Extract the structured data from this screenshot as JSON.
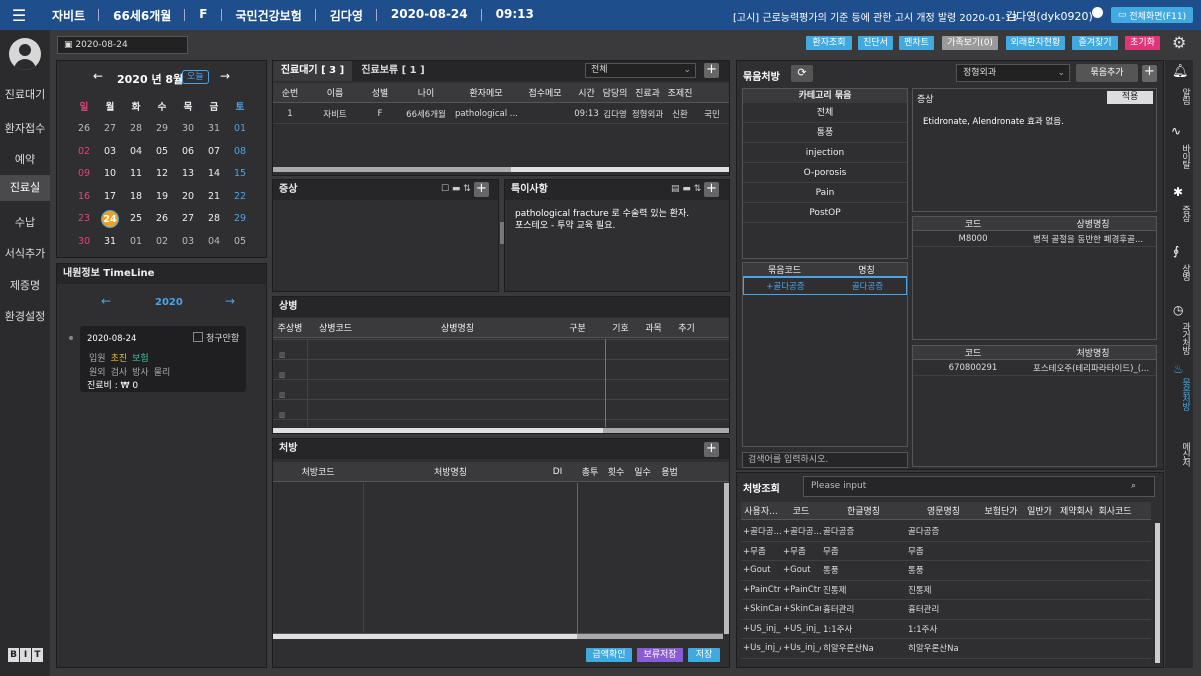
{
  "topbar": {
    "patient_items": [
      "자비트",
      "66세6개월",
      "F",
      "국민건강보험",
      "김다영",
      "2020-08-24",
      "09:13"
    ],
    "notice": "[고시] 근로능력평가의 기준 등에 관한 고시 개정 발령 2020-01-13",
    "user": "김다영(dyk0920)",
    "full_screen_label": "전체화면(F11)"
  },
  "nav": {
    "items": [
      "진료대기",
      "환자접수",
      "예약",
      "진료실",
      "수납",
      "서식추가",
      "제증명",
      "환경설정"
    ],
    "active": "진료실",
    "logo_letters": [
      "B",
      "I",
      "T"
    ]
  },
  "date_field": "2020-08-24",
  "toolbar_buttons": [
    {
      "label": "환자조회",
      "color": "#3fa9e0"
    },
    {
      "label": "진단서",
      "color": "#3fa9e0"
    },
    {
      "label": "펜차트",
      "color": "#3fa9e0"
    },
    {
      "label": "가족보기(0)",
      "color": "#9a9a9a"
    },
    {
      "label": "외래환자현황",
      "color": "#3fa9e0"
    },
    {
      "label": "즐겨찾기",
      "color": "#3fa9e0"
    },
    {
      "label": "초기화",
      "color": "#e0357a"
    }
  ],
  "calendar": {
    "title": "2020 년 8월",
    "today_label": "오늘",
    "weekdays": [
      "일",
      "월",
      "화",
      "수",
      "목",
      "금",
      "토"
    ],
    "weeks": [
      [
        "26",
        "27",
        "28",
        "29",
        "30",
        "31",
        "01"
      ],
      [
        "02",
        "03",
        "04",
        "05",
        "06",
        "07",
        "08"
      ],
      [
        "09",
        "10",
        "11",
        "12",
        "13",
        "14",
        "15"
      ],
      [
        "16",
        "17",
        "18",
        "19",
        "20",
        "21",
        "22"
      ],
      [
        "23",
        "24",
        "25",
        "26",
        "27",
        "28",
        "29"
      ],
      [
        "30",
        "31",
        "01",
        "02",
        "03",
        "04",
        "05"
      ]
    ],
    "selected": "24"
  },
  "timeline": {
    "title": "내원정보 TimeLine",
    "year": "2020",
    "card": {
      "date": "2020-08-24",
      "check_label": "청구안함",
      "line1": [
        "입원",
        "초진",
        "보험"
      ],
      "line2": [
        "원외",
        "검사",
        "방사",
        "물리"
      ],
      "fee": "진료비 : ₩ 0"
    }
  },
  "waiting": {
    "tabs": [
      "진료대기 [ 3 ]",
      "진료보류 [ 1 ]"
    ],
    "filter": "전체",
    "columns": [
      "순번",
      "이름",
      "성별",
      "나이",
      "환자메모",
      "접수메모",
      "시간",
      "담당의",
      "진료과",
      "조제진"
    ],
    "rows": [
      [
        "1",
        "자비트",
        "F",
        "66세6개월",
        "pathological ...",
        "",
        "09:13",
        "김다영",
        "정형외과",
        "신환",
        "국민"
      ]
    ]
  },
  "symptom": {
    "title": "증상"
  },
  "special": {
    "title": "특이사항",
    "lines": [
      "pathological fracture 로 수술력 있는 환자.",
      "포스테오 - 투약 교육 필요."
    ]
  },
  "disease": {
    "title": "상병",
    "columns": [
      "주상병",
      "상병코드",
      "상병명칭",
      "구분",
      "기호",
      "과목",
      "추기"
    ]
  },
  "prescription": {
    "title": "처방",
    "columns": [
      "처방코드",
      "처방명칭",
      "DI",
      "총투",
      "횟수",
      "일수",
      "용법"
    ],
    "buttons": [
      {
        "label": "금액확인",
        "color": "#3fa9e0"
      },
      {
        "label": "보류저장",
        "color": "#8a5bd6"
      },
      {
        "label": "저장",
        "color": "#3fa9e0"
      }
    ]
  },
  "bundle": {
    "title": "묶음처방",
    "dept": "정형외과",
    "add_label": "묶음추가",
    "category_header": "카테고리 묶음",
    "categories": [
      "전체",
      "통풍",
      "injection",
      "O-porosis",
      "Pain",
      "PostOP"
    ],
    "code_header": [
      "묶음코드",
      "명칭"
    ],
    "code_rows": [
      [
        "+골다공증",
        "골다공증"
      ]
    ],
    "search_placeholder": "검색어를 입력하시오.",
    "symptom_label": "증상",
    "apply_label": "적용",
    "symptom_text": "Etidronate, Alendronate 효과 없음.",
    "disease_header": [
      "코드",
      "상병명칭"
    ],
    "disease_rows": [
      [
        "M8000",
        "병적 골절을 동반한 폐경후골..."
      ]
    ],
    "drug_header": [
      "코드",
      "처방명칭"
    ],
    "drug_rows": [
      [
        "670800291",
        "포스테오주(테리파라타이드)_(..."
      ]
    ]
  },
  "lookup": {
    "title": "처방조회",
    "placeholder": "Please input",
    "columns": [
      "사용자...",
      "코드",
      "한글명칭",
      "영문명칭",
      "보험단가",
      "일반가",
      "제약회사",
      "회사코드"
    ],
    "rows": [
      [
        "+골다공...",
        "+골다공...",
        "골다공증",
        "골다공증"
      ],
      [
        "+무좀",
        "+무좀",
        "무좀",
        "무좀"
      ],
      [
        "+Gout",
        "+Gout",
        "통풍",
        "통풍"
      ],
      [
        "+PainCtrl",
        "+PainCtrl",
        "진통제",
        "진통제"
      ],
      [
        "+SkinCare",
        "+SkinCare",
        "흉터관리",
        "흉터관리"
      ],
      [
        "+US_inj_",
        "+US_inj_",
        "1:1주사",
        "1:1주사"
      ],
      [
        "+Us_inj_A",
        "+Us_inj_A",
        "히알우론산Na",
        "히알우론산Na"
      ]
    ]
  },
  "right_tabs": [
    {
      "label": "알림",
      "icon": "bell-icon"
    },
    {
      "label": "바이탈",
      "icon": "vital-icon"
    },
    {
      "label": "증상",
      "icon": "person-icon"
    },
    {
      "label": "상병",
      "icon": "stethoscope-icon"
    },
    {
      "label": "과거처방",
      "icon": "history-icon"
    },
    {
      "label": "묶음처방",
      "icon": "bundle-icon",
      "active": true
    },
    {
      "label": "메신저",
      "icon": ""
    }
  ]
}
